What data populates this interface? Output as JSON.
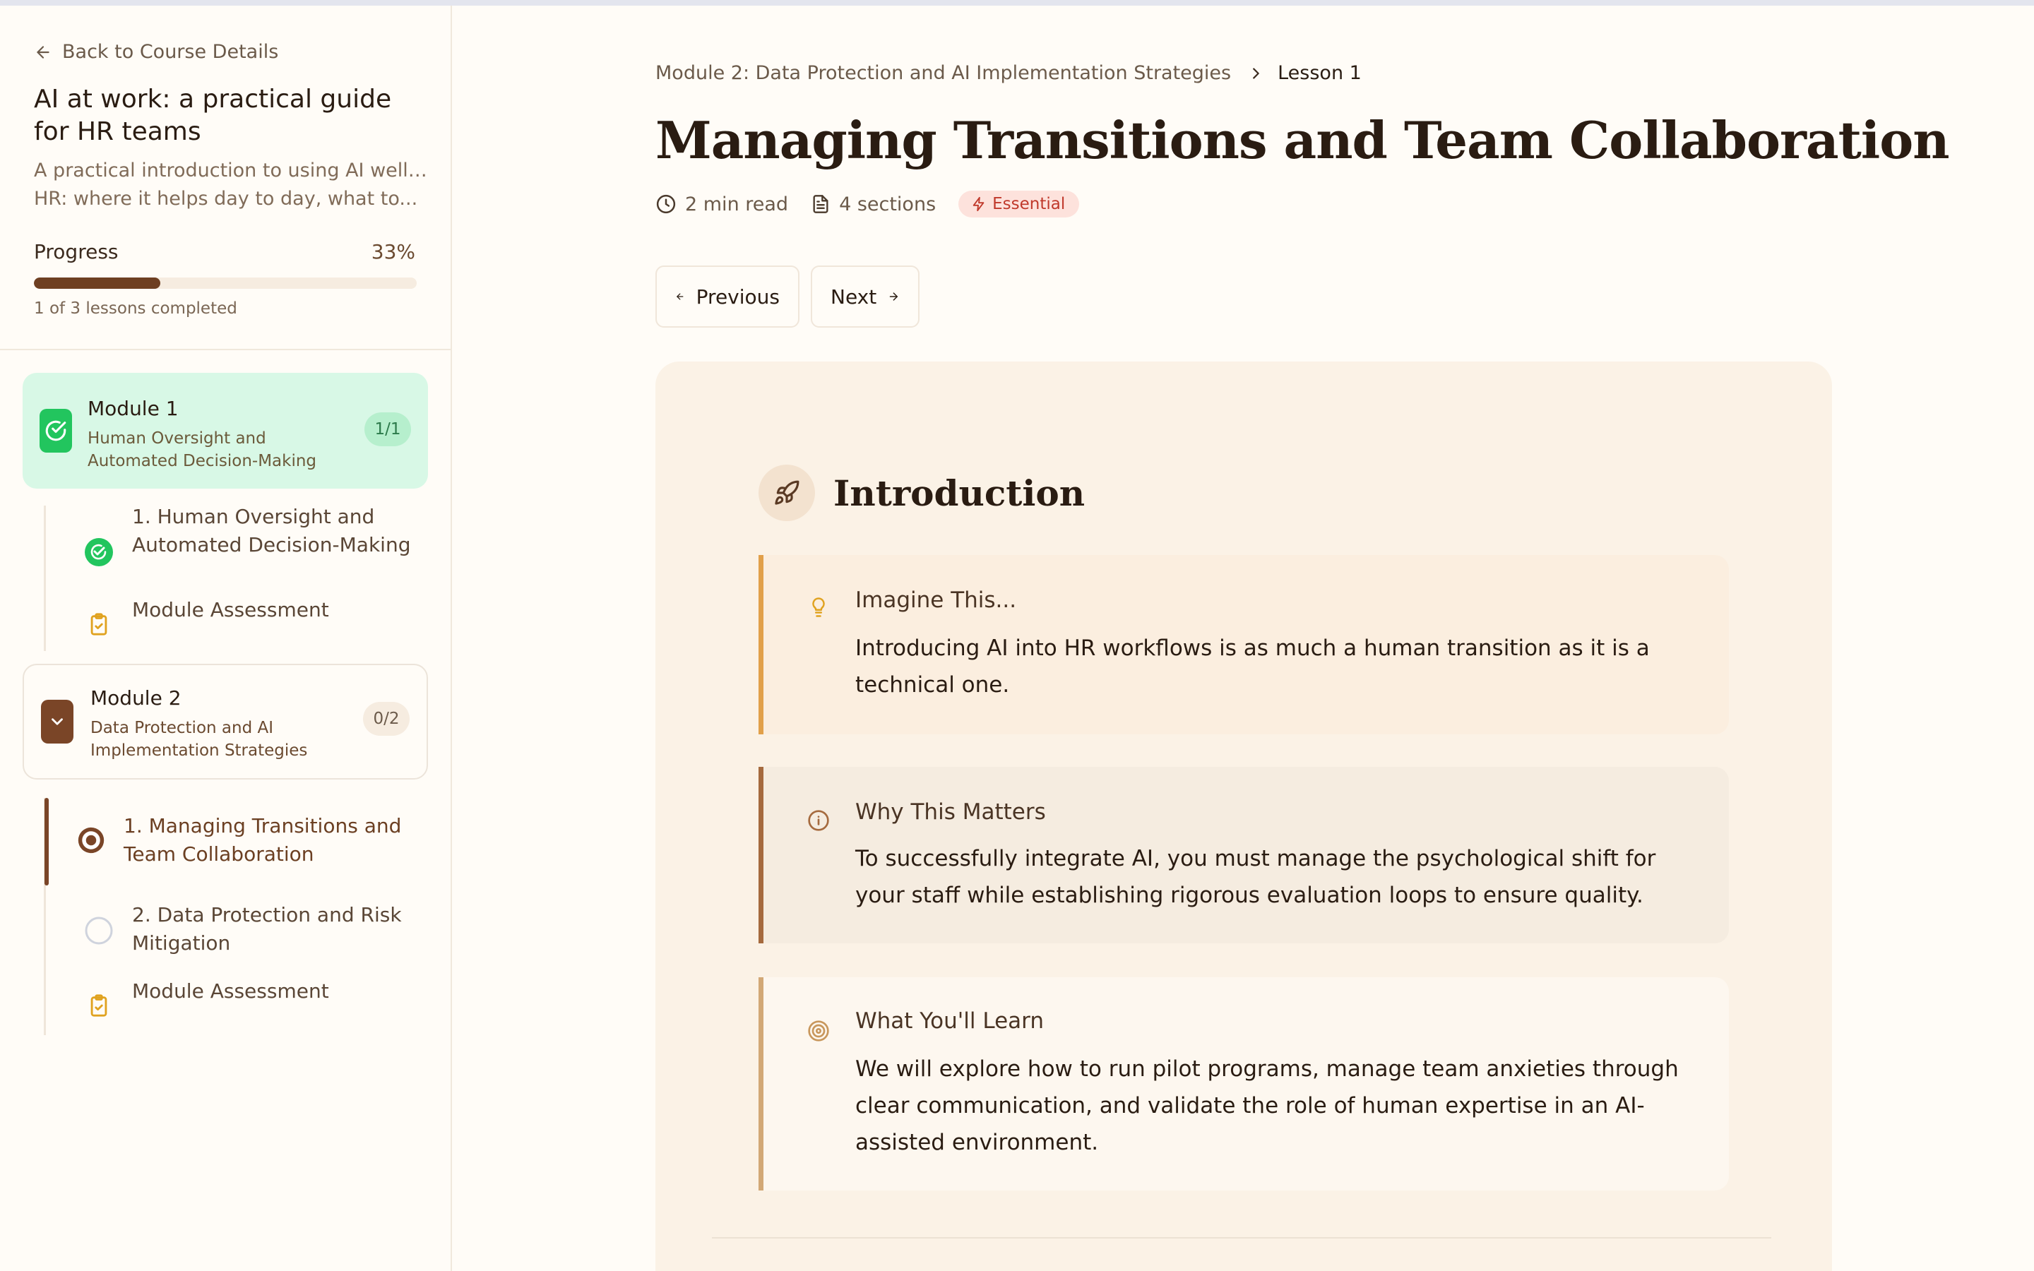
{
  "sidebar": {
    "back_label": "Back to Course Details",
    "course_title": "AI at work: a practical guide for HR teams",
    "course_desc_line1": "A practical introduction to using AI well in",
    "course_desc_line2": "HR: where it helps day to day, what to...",
    "progress_label": "Progress",
    "progress_percent": "33%",
    "progress_value": 0.33,
    "progress_caption": "1 of 3 lessons completed",
    "modules": [
      {
        "name": "Module 1",
        "subtitle": "Human Oversight and Automated Decision-Making",
        "count": "1/1",
        "status": "completed",
        "icon": "check-circle-icon",
        "lessons": [
          {
            "label": "1. Human Oversight and Automated Decision-Making",
            "status": "completed",
            "icon": "check-circle-icon"
          },
          {
            "label": "Module Assessment",
            "status": "assessment",
            "icon": "clipboard-check-icon"
          }
        ]
      },
      {
        "name": "Module 2",
        "subtitle": "Data Protection and AI Implementation Strategies",
        "count": "0/2",
        "status": "expanded",
        "icon": "chevron-down-icon",
        "lessons": [
          {
            "label": "1. Managing Transitions and Team Collaboration",
            "status": "current",
            "icon": "radio-filled-icon"
          },
          {
            "label": "2. Data Protection and Risk Mitigation",
            "status": "not-started",
            "icon": "circle-outline-icon"
          },
          {
            "label": "Module Assessment",
            "status": "assessment",
            "icon": "clipboard-check-icon"
          }
        ]
      }
    ]
  },
  "main": {
    "breadcrumb": {
      "module": "Module 2: Data Protection and AI Implementation Strategies",
      "current": "Lesson 1"
    },
    "title": "Managing Transitions and Team Collaboration",
    "meta": {
      "read_time": "2 min read",
      "sections": "4 sections",
      "badge": "Essential"
    },
    "nav": {
      "previous": "Previous",
      "next": "Next"
    },
    "intro": {
      "heading": "Introduction",
      "callouts": [
        {
          "title": "Imagine This...",
          "body": "Introducing AI into HR workflows is as much a human transition as it is a technical one.",
          "icon": "lightbulb-icon"
        },
        {
          "title": "Why This Matters",
          "body": "To successfully integrate AI, you must manage the psychological shift for your staff while establishing rigorous evaluation loops to ensure quality.",
          "icon": "info-icon"
        },
        {
          "title": "What You'll Learn",
          "body": "We will explore how to run pilot programs, manage team anxieties through clear communication, and validate the role of human expertise in an AI-assisted environment.",
          "icon": "target-icon"
        }
      ]
    }
  },
  "colors": {
    "accent_brown": "#7a4527",
    "success_green": "#22c55e",
    "badge_red": "#c0392b",
    "background": "#fffcf7"
  }
}
